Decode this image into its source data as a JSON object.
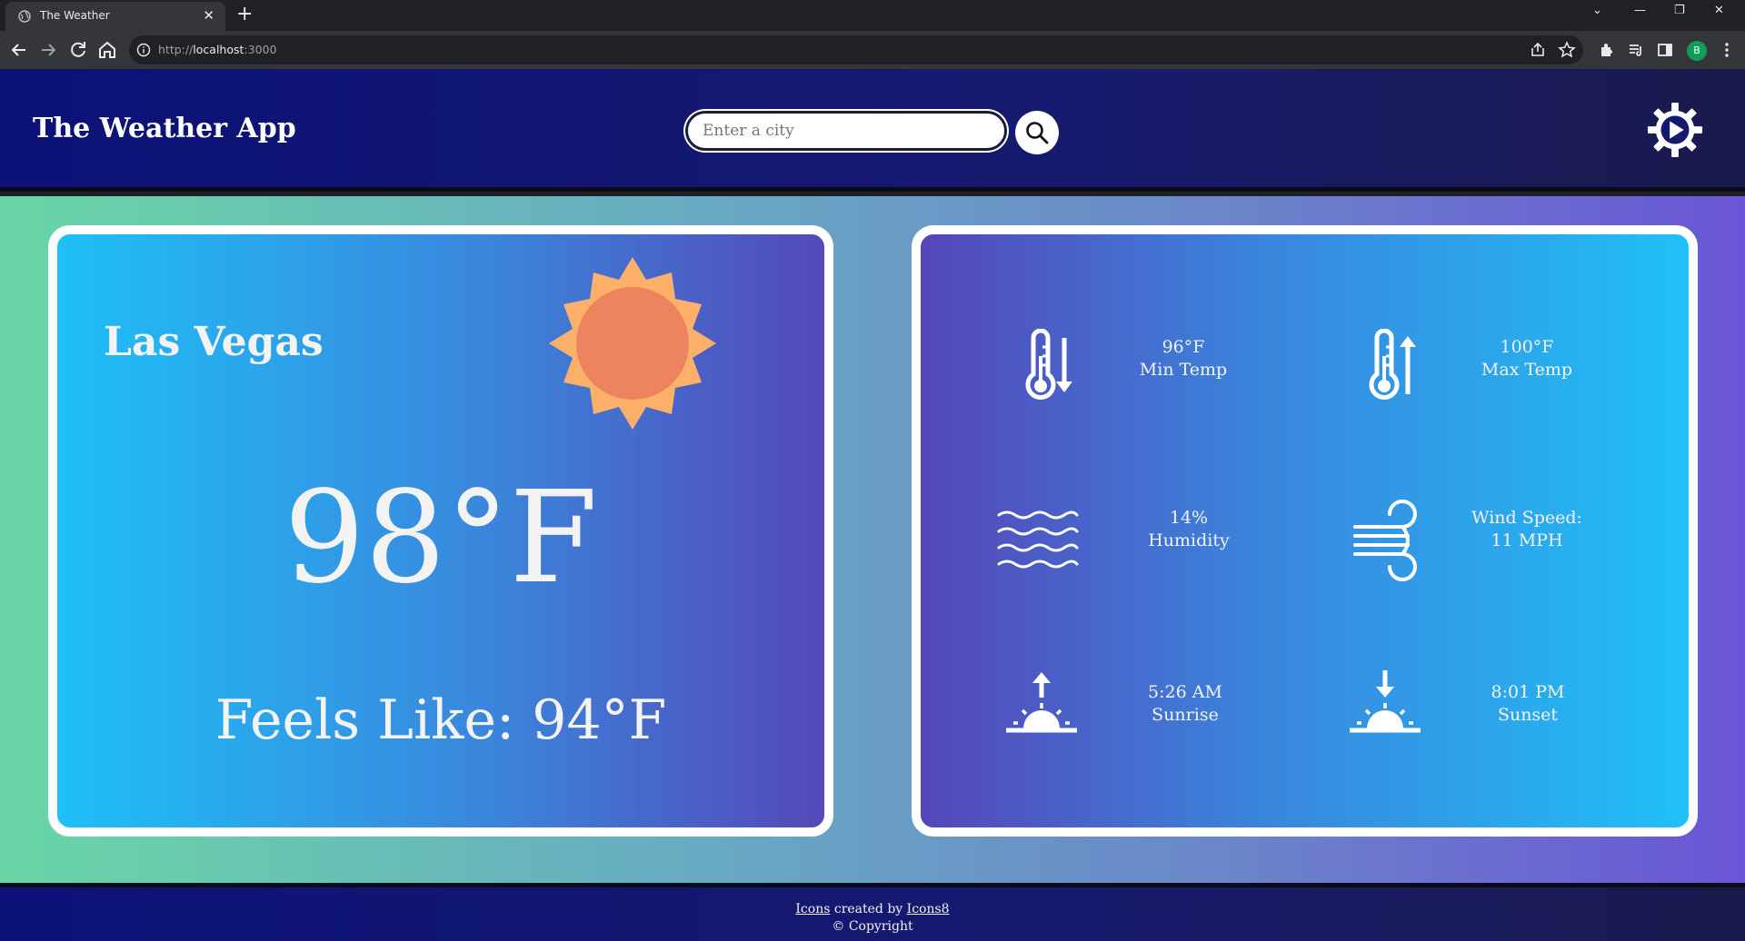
{
  "browser": {
    "tab_title": "The Weather",
    "url_scheme": "http://",
    "url_host": "localhost",
    "url_port": ":3000",
    "profile_initial": "B"
  },
  "header": {
    "title": "The Weather App",
    "search_placeholder": "Enter a city",
    "search_value": ""
  },
  "current": {
    "city": "Las Vegas",
    "temperature": "98°F",
    "feels_like": "Feels Like: 94°F",
    "condition_icon": "sun-icon"
  },
  "details": {
    "min_temp": {
      "value": "96°F",
      "label": "Min Temp",
      "icon": "thermometer-down-icon"
    },
    "max_temp": {
      "value": "100°F",
      "label": "Max Temp",
      "icon": "thermometer-up-icon"
    },
    "humidity": {
      "value": "14%",
      "label": "Humidity",
      "icon": "humidity-waves-icon"
    },
    "wind": {
      "label": "Wind Speed:",
      "value": "11 MPH",
      "icon": "wind-icon"
    },
    "sunrise": {
      "value": "5:26 AM",
      "label": "Sunrise",
      "icon": "sunrise-icon"
    },
    "sunset": {
      "value": "8:01 PM",
      "label": "Sunset",
      "icon": "sunset-icon"
    }
  },
  "footer": {
    "icons_link": "Icons",
    "created_by": " created by ",
    "icons8_link": "Icons8",
    "copyright": "© Copyright"
  },
  "colors": {
    "header_bg": "#0c1278",
    "card_text": "#f3f3f3",
    "sun_core": "#ec8460",
    "sun_rays": "#fdb06a"
  }
}
